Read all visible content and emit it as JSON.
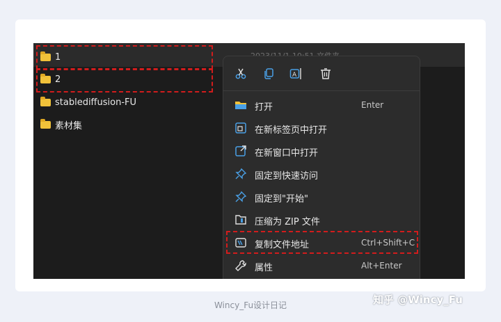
{
  "files": [
    {
      "name": "1",
      "icon": "folder-icon"
    },
    {
      "name": "2",
      "icon": "folder-icon"
    },
    {
      "name": "stablediffusion-FU",
      "icon": "folder-icon"
    },
    {
      "name": "素材集",
      "icon": "folder-icon"
    }
  ],
  "header_hint": "2023/11/1 10:51    文件夹",
  "toolbar": {
    "cut": "cut-icon",
    "copy": "copy-icon",
    "rename": "rename-icon",
    "delete": "trash-icon"
  },
  "menu_items": [
    {
      "label": "打开",
      "shortcut": "Enter",
      "icon": "folder-open-icon"
    },
    {
      "label": "在新标签页中打开",
      "shortcut": "",
      "icon": "new-tab-icon"
    },
    {
      "label": "在新窗口中打开",
      "shortcut": "",
      "icon": "new-window-icon"
    },
    {
      "label": "固定到快速访问",
      "shortcut": "",
      "icon": "pin-icon"
    },
    {
      "label": "固定到\"开始\"",
      "shortcut": "",
      "icon": "pin-icon"
    },
    {
      "label": "压缩为 ZIP 文件",
      "shortcut": "",
      "icon": "zip-icon"
    },
    {
      "label": "复制文件地址",
      "shortcut": "Ctrl+Shift+C",
      "icon": "copy-path-icon"
    },
    {
      "label": "属性",
      "shortcut": "Alt+Enter",
      "icon": "wrench-icon"
    }
  ],
  "caption": "Wincy_Fu设计日记",
  "watermark": "知乎 @Wincy_Fu",
  "colors": {
    "highlight": "#d21c1c",
    "folder": "#f1c23a",
    "accent": "#4aa0e6"
  }
}
